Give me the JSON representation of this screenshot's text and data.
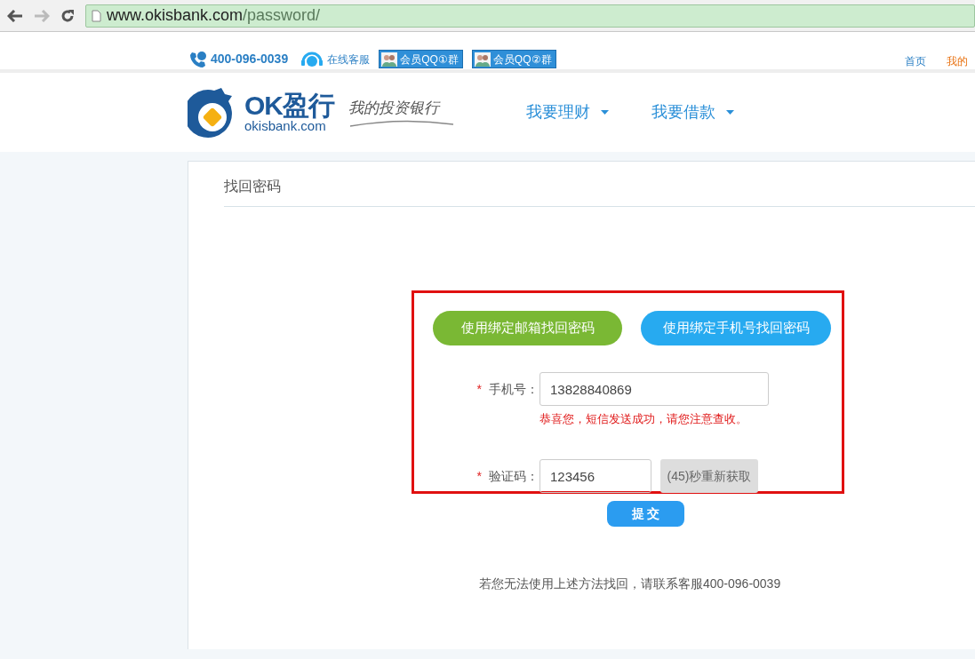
{
  "browser": {
    "url": "www.okisbank.com/password/"
  },
  "top_bar": {
    "hotline": "400-096-0039",
    "online_service": "在线客服",
    "qq_groups": [
      "会员QQ①群",
      "会员QQ②群"
    ],
    "links": [
      {
        "label": "首页",
        "color": "#2a7fc4"
      },
      {
        "label": "我的",
        "color": "#e8700f"
      }
    ]
  },
  "header": {
    "logo_name": "OK盈行",
    "logo_domain": "okisbank.com",
    "slogan": "我的投资银行",
    "nav": [
      "我要理财",
      "我要借款"
    ]
  },
  "page_title": "找回密码",
  "methods": [
    {
      "label": "使用绑定邮箱找回密码",
      "color": "#7ab834"
    },
    {
      "label": "使用绑定手机号找回密码",
      "color": "#27aaf0"
    }
  ],
  "fields": [
    {
      "label": "手机号：",
      "required_mark": "*",
      "value": "13828840869",
      "message": "恭喜您，短信发送成功，请您注意查收。"
    },
    {
      "label": "验证码：",
      "required_mark": "*",
      "value": "123456",
      "resend": {
        "label": "(45)秒重新获取",
        "disabled": true
      }
    }
  ],
  "submit": "提 交",
  "help_text": "若您无法使用上述方法找回，请联系客服400-096-0039"
}
